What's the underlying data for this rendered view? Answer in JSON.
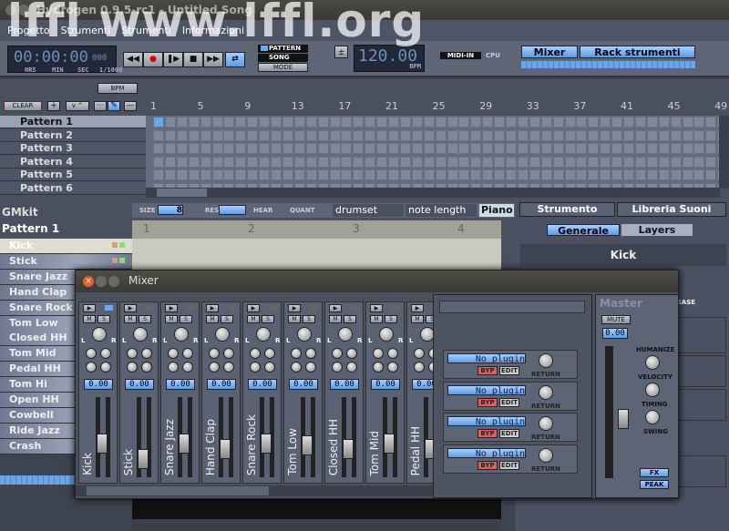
{
  "window": {
    "title": "Hydrogen 0.9.5-rc1 - Untitled Song",
    "watermark": "lffl www.lffl.org"
  },
  "menu": [
    "Progetto",
    "Strumenti",
    "Strumenti",
    "Informazioni"
  ],
  "toolbar": {
    "time": "00:00:00",
    "ms": "000",
    "time_labels": [
      "HRS",
      "MIN",
      "SEC",
      "1/1000"
    ],
    "transport": [
      "rewind",
      "record",
      "play-pause",
      "stop",
      "fast-forward",
      "loop"
    ],
    "mode": {
      "pattern": "PATTERN",
      "song": "SONG",
      "mode": "MODE",
      "selected": "PATTERN"
    },
    "bpm": "120.00",
    "bpm_label": "BPM",
    "midi_in": "MIDI-IN",
    "cpu": "CPU",
    "mixer": "Mixer",
    "rack": "Rack strumenti"
  },
  "song_editor": {
    "bpm_btn": "BPM",
    "clear": "CLEAR",
    "patterns": [
      "Pattern 1",
      "Pattern 2",
      "Pattern 3",
      "Pattern 4",
      "Pattern 5",
      "Pattern 6"
    ],
    "ruler": [
      "1",
      "5",
      "9",
      "13",
      "17",
      "21",
      "25",
      "29",
      "33",
      "37",
      "41",
      "45",
      "49"
    ],
    "active_cell": {
      "pattern": 1,
      "bar": 1
    }
  },
  "pattern_editor": {
    "kit": "GMkit",
    "pattern": "Pattern 1",
    "size_label": "SIZE",
    "size": "8",
    "res_label": "RES.",
    "hear": "HEAR",
    "quant": "QUANT",
    "drumset": "drumset",
    "note_length": "note length",
    "piano": "Piano",
    "beats": [
      "1",
      "2",
      "3",
      "4"
    ],
    "instruments": [
      "Kick",
      "Stick",
      "Snare Jazz",
      "Hand Clap",
      "Snare Rock",
      "Tom Low",
      "Closed HH",
      "Tom Mid",
      "Pedal HH",
      "Tom Hi",
      "Open HH",
      "Cowbell",
      "Ride Jazz",
      "Crash"
    ]
  },
  "instrument_panel": {
    "tab_instrument": "Strumento",
    "tab_library": "Libreria Suoni",
    "generale": "Generale",
    "layers": "Layers",
    "name": "Kick",
    "release": "EASE"
  },
  "mixer": {
    "title": "Mixer",
    "strips": [
      {
        "name": "Kick",
        "value": "0.00",
        "fader": 0.6
      },
      {
        "name": "Stick",
        "value": "0.00",
        "fader": 0.45
      },
      {
        "name": "Snare Jazz",
        "value": "0.00",
        "fader": 0.6
      },
      {
        "name": "Hand Clap",
        "value": "0.00",
        "fader": 0.55
      },
      {
        "name": "Snare Rock",
        "value": "0.00",
        "fader": 0.6
      },
      {
        "name": "Tom Low",
        "value": "0.00",
        "fader": 0.58
      },
      {
        "name": "Closed HH",
        "value": "0.00",
        "fader": 0.55
      },
      {
        "name": "Tom Mid",
        "value": "0.00",
        "fader": 0.6
      },
      {
        "name": "Pedal HH",
        "value": "0.00",
        "fader": 0.55
      }
    ],
    "mute": "M",
    "solo": "S",
    "pan_l": "L",
    "pan_r": "R",
    "fx": [
      {
        "name": "No plugin"
      },
      {
        "name": "No plugin"
      },
      {
        "name": "No plugin"
      },
      {
        "name": "No plugin"
      }
    ],
    "bypass": "BYP",
    "edit": "EDIT",
    "return": "RETURN",
    "master": {
      "title": "Master",
      "mute": "MUTE",
      "value": "0.00",
      "humanize": "HUMANIZE",
      "velocity": "VELOCITY",
      "timing": "TIMING",
      "swing": "SWING",
      "fx": "FX",
      "peak": "PEAK"
    }
  },
  "colors": {
    "accent": "#6aa6ee",
    "bypass": "#e06060",
    "lcd": "#20283a"
  }
}
